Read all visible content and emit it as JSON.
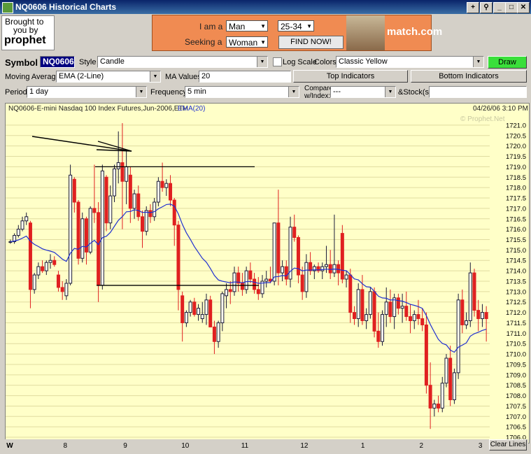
{
  "window": {
    "title": "NQ0606 Historical Charts"
  },
  "ad_left": {
    "line1": "Brought to",
    "line2": "you by",
    "logo": "prophet"
  },
  "ad": {
    "iam_label": "I am a",
    "iam_value": "Man",
    "age_value": "25-34",
    "seeking_label": "Seeking a",
    "seeking_value": "Woman",
    "find_button": "FIND NOW!",
    "brand": "match.com"
  },
  "toolbar": {
    "symbol_label": "Symbol",
    "symbol_value": "NQ0606",
    "style_label": "Style",
    "style_value": "Candle",
    "logscale_label": "Log Scale",
    "colors_label": "Colors",
    "colors_value": "Classic Yellow",
    "draw_button": "Draw Chart",
    "ma_label": "Moving Average",
    "ma_value": "EMA (2-Line)",
    "ma_values_label": "MA Values",
    "ma_values_value": "20",
    "top_indicators": "Top Indicators",
    "bottom_indicators": "Bottom Indicators",
    "period_label": "Period",
    "period_value": "1 day",
    "frequency_label": "Frequency",
    "frequency_value": "5 min",
    "compare_label1": "Compare",
    "compare_label2": "w/Index:",
    "compare_value": "---",
    "stocks_label": "&Stock(s)"
  },
  "chart_header": {
    "title": "NQ0606-E-mini Nasdaq 100 Index Futures,Jun-2006,ETH",
    "ema_label": "EMA(20)",
    "datetime": "04/26/06 3:10 PM",
    "watermark": "© Prophet.Net"
  },
  "colors": {
    "up": "#1a1a3a",
    "down": "#e02020",
    "ema": "#2030d0",
    "background": "#ffffc8"
  },
  "x_axis": {
    "ticks": [
      "W",
      "8",
      "9",
      "10",
      "11",
      "12",
      "1",
      "2",
      "3"
    ],
    "clear_lines": "Clear Lines"
  },
  "chart_data": {
    "type": "candlestick",
    "title": "NQ0606-E-mini Nasdaq 100 Index Futures,Jun-2006,ETH",
    "y_ticks": [
      "1721.0",
      "1720.5",
      "1720.0",
      "1719.5",
      "1719.0",
      "1718.5",
      "1718.0",
      "1717.5",
      "1717.0",
      "1716.5",
      "1716.0",
      "1715.5",
      "1715.0",
      "1714.5",
      "1714.0",
      "1713.5",
      "1713.0",
      "1712.5",
      "1712.0",
      "1711.5",
      "1711.0",
      "1710.5",
      "1710.0",
      "1709.5",
      "1709.0",
      "1708.5",
      "1708.0",
      "1707.5",
      "1707.0",
      "1706.5",
      "1706.0"
    ],
    "ylim": [
      1705.8,
      1721.3
    ],
    "x_categories": [
      "W",
      "8",
      "9",
      "10",
      "11",
      "12",
      "1",
      "2",
      "3"
    ],
    "candles": [
      [
        1715.4,
        1715.5,
        1715.3,
        1715.4
      ],
      [
        1715.4,
        1715.8,
        1715.3,
        1715.7
      ],
      [
        1715.7,
        1716.2,
        1715.6,
        1716.0
      ],
      [
        1716.0,
        1716.6,
        1715.9,
        1716.4
      ],
      [
        1716.4,
        1716.8,
        1716.2,
        1716.6
      ],
      [
        1716.3,
        1716.4,
        1712.2,
        1713.1
      ],
      [
        1713.1,
        1713.9,
        1712.9,
        1713.8
      ],
      [
        1713.8,
        1714.4,
        1713.6,
        1714.2
      ],
      [
        1714.2,
        1714.5,
        1713.9,
        1714.0
      ],
      [
        1714.0,
        1714.5,
        1713.8,
        1714.4
      ],
      [
        1714.4,
        1714.8,
        1714.1,
        1714.5
      ],
      [
        1714.5,
        1714.7,
        1714.2,
        1714.3
      ],
      [
        1713.8,
        1714.0,
        1713.0,
        1713.2
      ],
      [
        1713.2,
        1713.5,
        1712.6,
        1713.0
      ],
      [
        1712.8,
        1713.6,
        1712.6,
        1713.4
      ],
      [
        1713.4,
        1719.1,
        1713.3,
        1718.6
      ],
      [
        1718.4,
        1718.5,
        1716.8,
        1717.3
      ],
      [
        1717.3,
        1717.4,
        1714.3,
        1714.6
      ],
      [
        1714.6,
        1716.8,
        1714.4,
        1716.5
      ],
      [
        1716.5,
        1716.6,
        1714.3,
        1714.9
      ],
      [
        1714.9,
        1717.1,
        1714.8,
        1717.0
      ],
      [
        1717.0,
        1719.1,
        1716.3,
        1716.8
      ],
      [
        1716.8,
        1717.3,
        1712.5,
        1713.3
      ],
      [
        1713.3,
        1719.1,
        1713.1,
        1718.8
      ],
      [
        1718.5,
        1718.6,
        1715.9,
        1716.3
      ],
      [
        1716.3,
        1718.1,
        1716.0,
        1717.6
      ],
      [
        1717.6,
        1719.1,
        1717.3,
        1718.9
      ],
      [
        1718.9,
        1720.7,
        1718.2,
        1719.2
      ],
      [
        1719.2,
        1721.1,
        1716.0,
        1718.3
      ],
      [
        1718.3,
        1719.8,
        1717.2,
        1719.0
      ],
      [
        1718.6,
        1719.0,
        1716.3,
        1717.0
      ],
      [
        1717.0,
        1717.9,
        1716.5,
        1717.7
      ],
      [
        1717.7,
        1718.1,
        1716.4,
        1716.6
      ],
      [
        1716.6,
        1716.9,
        1715.1,
        1715.9
      ],
      [
        1715.9,
        1717.1,
        1715.7,
        1716.9
      ],
      [
        1716.9,
        1717.2,
        1716.3,
        1716.6
      ],
      [
        1716.6,
        1717.5,
        1716.4,
        1717.3
      ],
      [
        1717.3,
        1718.5,
        1717.1,
        1718.3
      ],
      [
        1718.3,
        1719.2,
        1717.8,
        1718.0
      ],
      [
        1718.0,
        1718.4,
        1717.6,
        1718.2
      ],
      [
        1718.2,
        1718.6,
        1717.1,
        1717.4
      ],
      [
        1717.4,
        1717.5,
        1715.2,
        1716.2
      ],
      [
        1716.2,
        1716.4,
        1712.1,
        1713.1
      ],
      [
        1712.8,
        1713.0,
        1710.6,
        1711.5
      ],
      [
        1711.5,
        1712.1,
        1711.3,
        1712.0
      ],
      [
        1712.0,
        1712.6,
        1711.8,
        1712.5
      ],
      [
        1712.5,
        1712.7,
        1711.8,
        1711.9
      ],
      [
        1711.9,
        1712.4,
        1711.6,
        1712.2
      ],
      [
        1711.7,
        1712.5,
        1711.5,
        1711.9
      ],
      [
        1711.9,
        1712.9,
        1711.4,
        1712.6
      ],
      [
        1712.6,
        1712.8,
        1711.4,
        1711.3
      ],
      [
        1711.3,
        1711.6,
        1710.0,
        1710.6
      ],
      [
        1710.6,
        1711.6,
        1710.3,
        1711.5
      ],
      [
        1711.5,
        1713.0,
        1711.1,
        1712.9
      ],
      [
        1712.8,
        1713.4,
        1712.2,
        1713.1
      ],
      [
        1713.1,
        1713.5,
        1712.4,
        1713.0
      ],
      [
        1713.0,
        1714.2,
        1712.8,
        1713.9
      ],
      [
        1713.9,
        1714.2,
        1713.0,
        1713.4
      ],
      [
        1713.4,
        1713.9,
        1712.8,
        1713.1
      ],
      [
        1713.1,
        1714.2,
        1712.9,
        1714.0
      ],
      [
        1714.0,
        1714.4,
        1713.4,
        1713.6
      ],
      [
        1713.6,
        1713.9,
        1712.9,
        1713.1
      ],
      [
        1713.1,
        1713.7,
        1712.6,
        1712.9
      ],
      [
        1712.9,
        1713.8,
        1712.7,
        1713.5
      ],
      [
        1713.5,
        1714.0,
        1713.2,
        1713.6
      ],
      [
        1713.6,
        1714.2,
        1713.4,
        1713.5
      ],
      [
        1713.5,
        1714.8,
        1713.3,
        1716.3
      ],
      [
        1716.3,
        1717.9,
        1713.3,
        1713.9
      ],
      [
        1713.9,
        1714.5,
        1713.5,
        1714.2
      ],
      [
        1714.2,
        1714.5,
        1713.3,
        1713.6
      ],
      [
        1713.6,
        1716.6,
        1713.2,
        1716.1
      ],
      [
        1716.1,
        1716.7,
        1715.4,
        1715.6
      ],
      [
        1715.6,
        1715.7,
        1713.4,
        1713.8
      ],
      [
        1713.8,
        1714.2,
        1712.6,
        1713.0
      ],
      [
        1713.0,
        1714.8,
        1712.7,
        1714.4
      ],
      [
        1714.4,
        1714.9,
        1713.8,
        1714.0
      ],
      [
        1714.0,
        1714.3,
        1713.6,
        1714.2
      ],
      [
        1714.2,
        1714.4,
        1713.9,
        1714.0
      ],
      [
        1714.0,
        1714.4,
        1713.6,
        1714.2
      ],
      [
        1714.2,
        1715.2,
        1713.9,
        1714.3
      ],
      [
        1714.3,
        1715.0,
        1713.6,
        1713.9
      ],
      [
        1713.9,
        1716.7,
        1713.7,
        1714.3
      ],
      [
        1714.3,
        1714.5,
        1713.3,
        1713.9
      ],
      [
        1715.8,
        1716.2,
        1713.4,
        1713.6
      ],
      [
        1713.6,
        1714.0,
        1713.2,
        1713.8
      ],
      [
        1713.8,
        1714.1,
        1711.5,
        1712.0
      ],
      [
        1712.0,
        1712.3,
        1711.4,
        1711.7
      ],
      [
        1711.7,
        1713.4,
        1711.3,
        1713.1
      ],
      [
        1713.1,
        1713.8,
        1711.4,
        1711.6
      ],
      [
        1711.6,
        1712.2,
        1711.2,
        1711.9
      ],
      [
        1711.9,
        1713.2,
        1711.7,
        1713.0
      ],
      [
        1713.0,
        1713.2,
        1710.8,
        1711.1
      ],
      [
        1711.1,
        1712.0,
        1710.3,
        1710.6
      ],
      [
        1710.6,
        1712.1,
        1710.4,
        1711.9
      ],
      [
        1711.9,
        1713.2,
        1711.3,
        1712.5
      ],
      [
        1712.5,
        1713.1,
        1711.5,
        1711.8
      ],
      [
        1711.8,
        1712.9,
        1711.2,
        1712.7
      ],
      [
        1712.7,
        1712.9,
        1711.9,
        1712.2
      ],
      [
        1712.2,
        1712.9,
        1711.5,
        1712.3
      ],
      [
        1712.3,
        1713.0,
        1711.6,
        1711.8
      ],
      [
        1711.8,
        1712.4,
        1711.0,
        1711.6
      ],
      [
        1711.6,
        1712.1,
        1711.2,
        1711.9
      ],
      [
        1711.9,
        1712.6,
        1711.4,
        1711.7
      ],
      [
        1711.7,
        1712.2,
        1711.1,
        1711.4
      ],
      [
        1711.4,
        1712.0,
        1708.1,
        1708.5
      ],
      [
        1708.5,
        1709.6,
        1706.4,
        1707.4
      ],
      [
        1707.4,
        1707.8,
        1707.0,
        1707.6
      ],
      [
        1707.6,
        1708.0,
        1707.2,
        1707.4
      ],
      [
        1707.4,
        1708.9,
        1707.2,
        1708.6
      ],
      [
        1708.6,
        1710.0,
        1708.4,
        1709.8
      ],
      [
        1709.8,
        1710.4,
        1707.5,
        1707.8
      ],
      [
        1707.8,
        1709.3,
        1707.6,
        1709.1
      ],
      [
        1709.1,
        1712.9,
        1708.8,
        1712.6
      ],
      [
        1712.6,
        1713.1,
        1711.0,
        1711.4
      ],
      [
        1711.4,
        1712.0,
        1711.2,
        1711.6
      ],
      [
        1711.6,
        1714.4,
        1711.3,
        1713.9
      ],
      [
        1713.9,
        1714.1,
        1711.8,
        1712.1
      ],
      [
        1712.1,
        1712.6,
        1711.1,
        1711.7
      ],
      [
        1711.7,
        1712.4,
        1711.3,
        1712.0
      ],
      [
        1712.0,
        1712.3,
        1710.6,
        1711.7
      ]
    ],
    "ema_period": 20,
    "annotations": [
      "trend arrow",
      "range top line",
      "range bottom line"
    ]
  }
}
